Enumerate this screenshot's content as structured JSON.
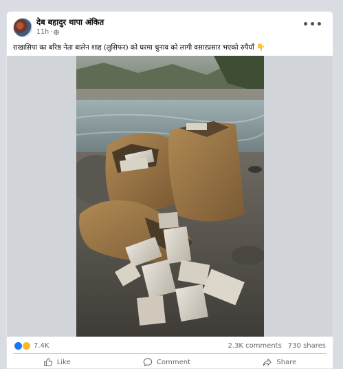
{
  "post": {
    "author": "देब बहादुर थापा अंकित",
    "time": "11h",
    "more_label": "•••",
    "caption": "राखासिपा का बरिष्ठ नेता बालेन शाह (लुसिफर) को घरमा चुनाव को लागी वसारप्रसार  भएको रुपैयाँ 👇",
    "icons": {
      "privacy": "globe-icon",
      "more": "more-options-icon"
    }
  },
  "stats": {
    "reactions_count": "7.4K",
    "comments": "2.3K comments",
    "shares": "730 shares"
  },
  "actions": {
    "like": "Like",
    "comment": "Comment",
    "share": "Share"
  },
  "colors": {
    "accent": "#1877f2",
    "text": "#050505",
    "muted": "#65676b"
  }
}
